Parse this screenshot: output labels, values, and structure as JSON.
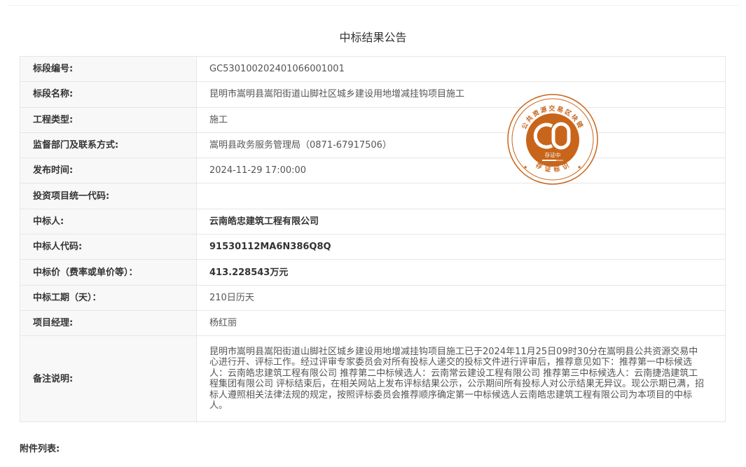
{
  "page_title": "中标结果公告",
  "rows": [
    {
      "label": "标段编号:",
      "value": "GC5301002024010660010​01"
    },
    {
      "label": "标段名称:",
      "value": "昆明市嵩明县嵩阳街道山脚社区城乡建设用地增减挂钩项目施工"
    },
    {
      "label": "工程类型:",
      "value": "施工"
    },
    {
      "label": "监督部门及联系方式:",
      "value": "嵩明县政务服务管理局（0871-67917506）"
    },
    {
      "label": "发布时间:",
      "value": "2024-11-29 17:00:00"
    },
    {
      "label": "投资项目统一代码:",
      "value": ""
    },
    {
      "label": "中标人:",
      "value": "云南皓忠建筑工程有限公司"
    },
    {
      "label": "中标人代码:",
      "value": "91530112MA6N386Q8Q"
    },
    {
      "label": "中标价（费率或单价等）：",
      "value": "413.228543万元"
    },
    {
      "label": "中标工期（天）：",
      "value": "210日历天"
    },
    {
      "label": "项目经理:",
      "value": "杨红丽"
    },
    {
      "label": "备注说明:",
      "value": "昆明市嵩明县嵩阳街道山脚社区城乡建设用地增减挂钩项目施工已于2024年11月25日09时30分在嵩明县公共资源交易中心进行开、评标工作。经过评审专家委员会对所有投标人递交的投标文件进行评审后，推荐意见如下：推荐第一中标候选人：云南皓忠建筑工程有限公司 推荐第二中标候选人：云南常云建设工程有限公司 推荐第三中标候选人：云南捷浩建筑工程集团有限公司 评标结束后，在相关网站上发布评标结果公示，公示期间所有投标人对公示结果无异议。现公示期已满，招标人遵照相关法律法规的规定，按照评标委员会推荐顺序确定第一中标候选人云南皓忠建筑工程有限公司为本项目的中标人。"
    }
  ],
  "seal": {
    "outer_text": "公共资源交易区块链",
    "inner_text": "存证中",
    "bottom_text": "存 证 标 识",
    "color": "#c8651b"
  },
  "attachments_label": "附件列表:"
}
